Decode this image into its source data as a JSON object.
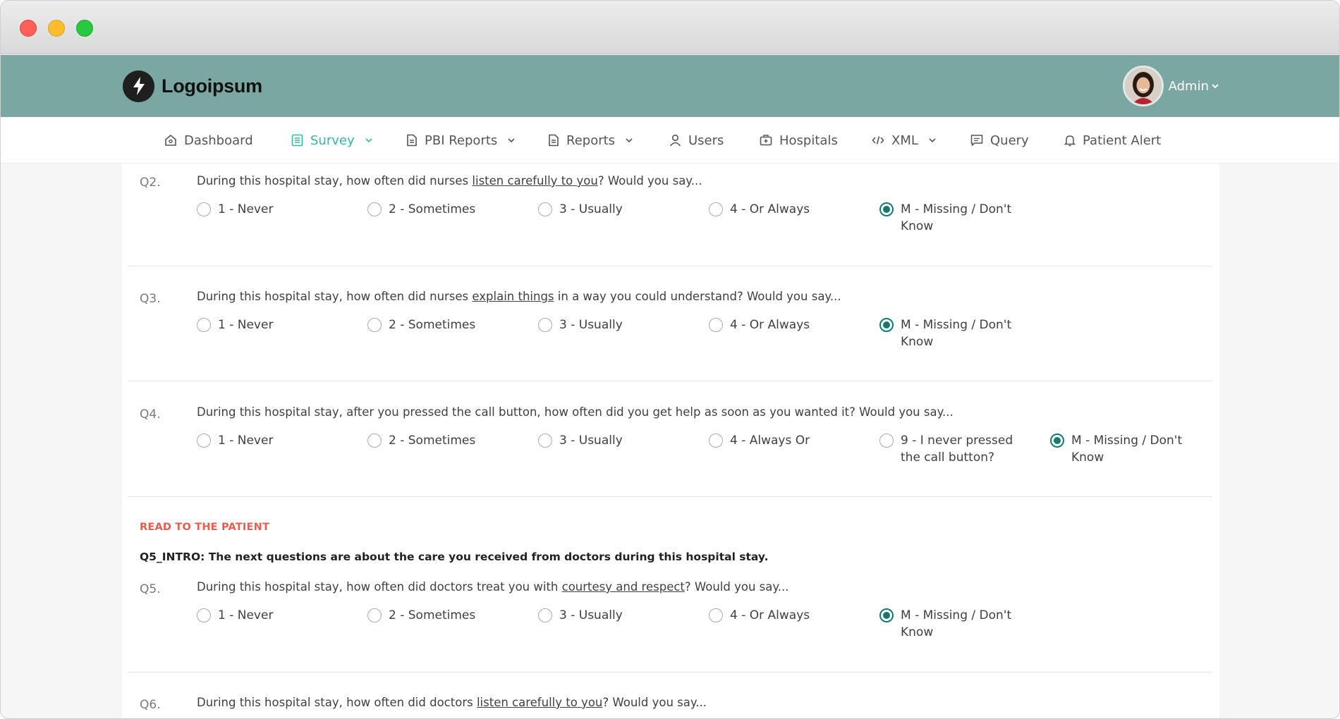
{
  "app": {
    "brand": "Logoipsum",
    "user_name": "Admin"
  },
  "nav": [
    {
      "label": "Dashboard",
      "icon": "home-icon"
    },
    {
      "label": "Survey",
      "icon": "survey-icon",
      "active": true,
      "dropdown": true
    },
    {
      "label": "PBI Reports",
      "icon": "document-icon",
      "dropdown": true
    },
    {
      "label": "Reports",
      "icon": "document-icon",
      "dropdown": true
    },
    {
      "label": "Users",
      "icon": "user-icon"
    },
    {
      "label": "Hospitals",
      "icon": "hospital-icon"
    },
    {
      "label": "XML",
      "icon": "code-icon",
      "dropdown": true
    },
    {
      "label": "Query",
      "icon": "chat-icon"
    },
    {
      "label": "Patient Alert",
      "icon": "bell-icon"
    }
  ],
  "colors": {
    "header": "#7ba7a2",
    "accent": "#37b5a6",
    "radio_checked": "#137a70",
    "read_label": "#ee5a4e"
  },
  "questions": [
    {
      "number": "Q2.",
      "text_before": "During this hospital stay, how often did nurses ",
      "text_underlined": "listen carefully to you",
      "text_after": "? Would you say...",
      "options": [
        "1 - Never",
        "2 - Sometimes",
        "3 - Usually",
        "4 - Or Always",
        "M - Missing / Don't Know"
      ],
      "selected": 4
    },
    {
      "number": "Q3.",
      "text_before": "During this hospital stay, how often did nurses ",
      "text_underlined": "explain things",
      "text_after": " in a way you could understand? Would you say...",
      "options": [
        "1 - Never",
        "2 - Sometimes",
        "3 - Usually",
        "4 - Or Always",
        "M - Missing / Don't Know"
      ],
      "selected": 4
    },
    {
      "number": "Q4.",
      "text_before": "During this hospital stay, after you pressed the call button, how often did you get help as soon as you wanted it? Would you say...",
      "text_underlined": "",
      "text_after": "",
      "options": [
        "1 - Never",
        "2 - Sometimes",
        "3 - Usually",
        "4 - Always Or",
        "9 - I never pressed the call button?",
        "M - Missing / Don't Know"
      ],
      "selected": 5
    },
    {
      "number": "Q5.",
      "text_before": "During this hospital stay, how often did doctors treat you with ",
      "text_underlined": "courtesy and respect",
      "text_after": "? Would you say...",
      "options": [
        "1 - Never",
        "2 - Sometimes",
        "3 - Usually",
        "4 - Or Always",
        "M - Missing / Don't Know"
      ],
      "selected": 4
    },
    {
      "number": "Q6.",
      "text_before": "During this hospital stay, how often did doctors ",
      "text_underlined": "listen carefully to you",
      "text_after": "? Would you say...",
      "options": [],
      "selected": null
    }
  ],
  "section": {
    "read_label": "READ TO THE PATIENT",
    "intro": "Q5_INTRO: The next questions are about the care you received from doctors during this hospital stay."
  }
}
